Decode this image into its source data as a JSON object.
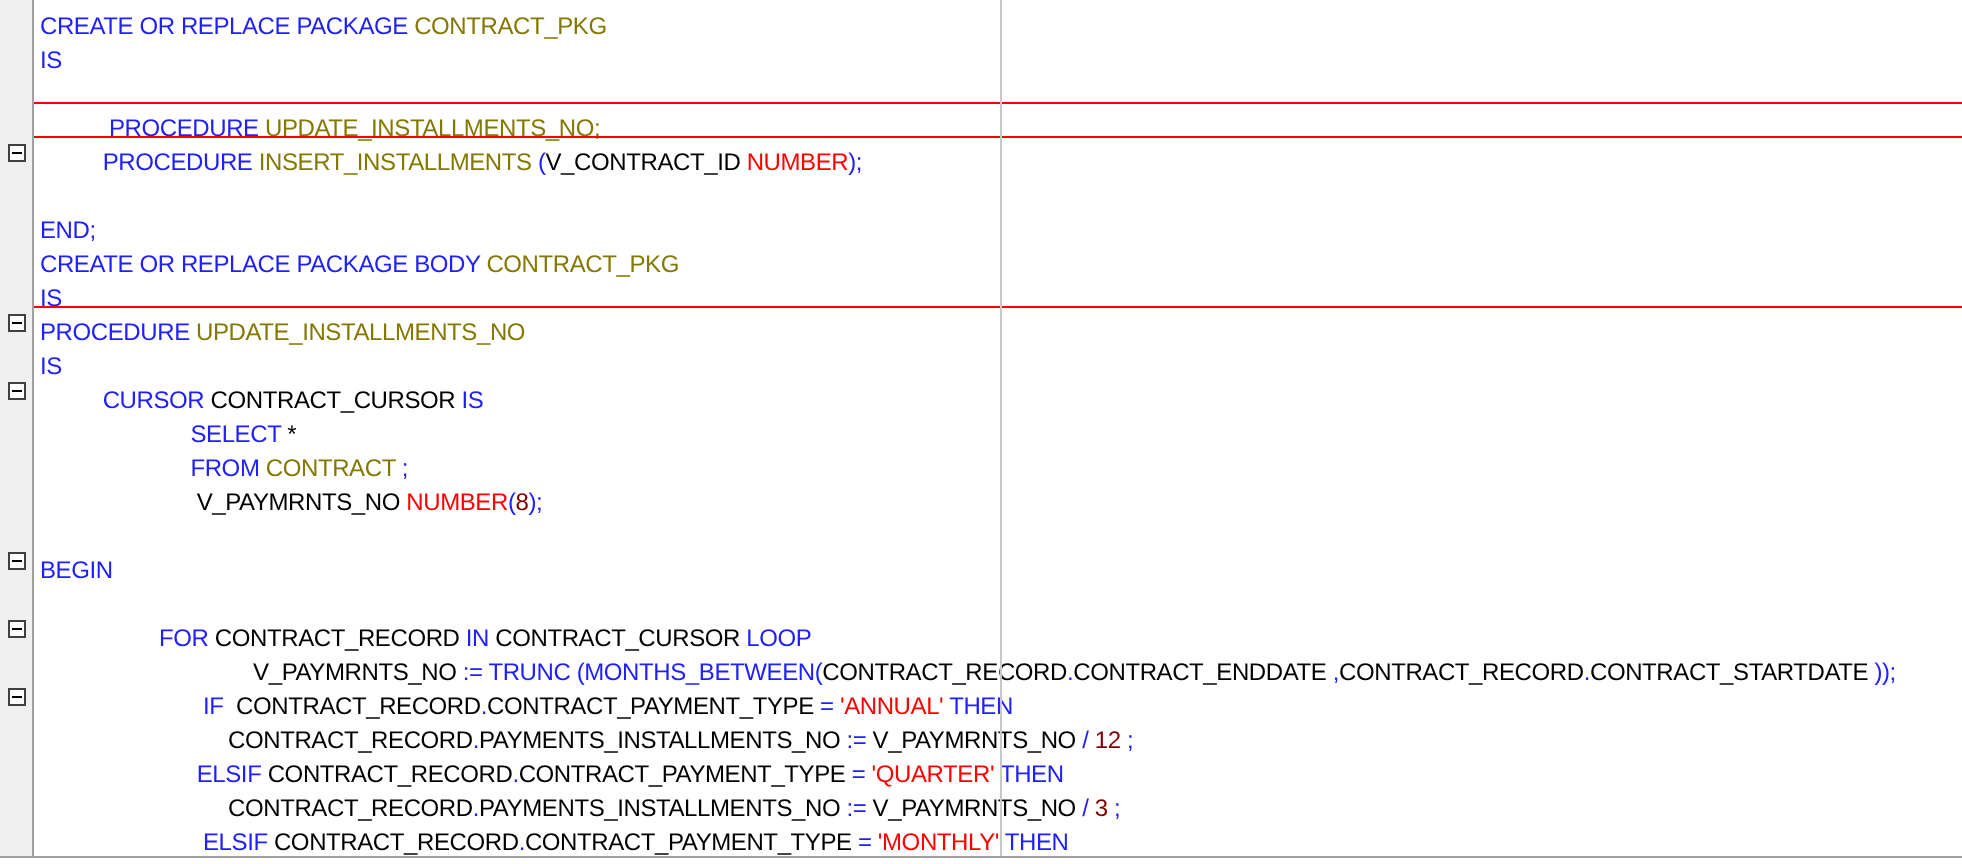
{
  "editor": {
    "lines": [
      {
        "separator": false,
        "tokens": [
          {
            "text": "CREATE OR REPLACE PACKAGE ",
            "kind": "keyword"
          },
          {
            "text": "CONTRACT_PKG",
            "kind": "identifier"
          }
        ]
      },
      {
        "separator": false,
        "tokens": [
          {
            "text": "IS",
            "kind": "keyword"
          }
        ]
      },
      {
        "separator": false
      },
      {
        "separator": true,
        "tokens": [
          {
            "text": "           PROCEDURE ",
            "kind": "keyword"
          },
          {
            "text": "UPDATE_INSTALLMENTS_NO;",
            "kind": "identifier"
          }
        ]
      },
      {
        "separator": true,
        "expanded": true,
        "tokens": [
          {
            "text": "          PROCEDURE ",
            "kind": "keyword"
          },
          {
            "text": "INSERT_INSTALLMENTS ",
            "kind": "identifier"
          },
          {
            "text": "(",
            "kind": "operator"
          },
          {
            "text": "V_CONTRACT_ID ",
            "kind": "plain"
          },
          {
            "text": "NUMBER",
            "kind": "type"
          },
          {
            "text": ");",
            "kind": "operator"
          }
        ]
      },
      {
        "separator": false
      },
      {
        "separator": false,
        "tokens": [
          {
            "text": "END;",
            "kind": "keyword"
          }
        ]
      },
      {
        "separator": false,
        "tokens": [
          {
            "text": "CREATE OR REPLACE PACKAGE BODY ",
            "kind": "keyword"
          },
          {
            "text": "CONTRACT_PKG",
            "kind": "identifier"
          }
        ]
      },
      {
        "separator": false,
        "tokens": [
          {
            "text": "IS",
            "kind": "keyword"
          }
        ]
      },
      {
        "separator": true,
        "expanded": true,
        "tokens": [
          {
            "text": "PROCEDURE ",
            "kind": "keyword"
          },
          {
            "text": "UPDATE_INSTALLMENTS_NO",
            "kind": "identifier"
          }
        ]
      },
      {
        "separator": false,
        "tokens": [
          {
            "text": "IS",
            "kind": "keyword"
          }
        ]
      },
      {
        "separator": false,
        "expanded": true,
        "tokens": [
          {
            "text": "          CURSOR ",
            "kind": "keyword"
          },
          {
            "text": "CONTRACT_CURSOR ",
            "kind": "plain"
          },
          {
            "text": "IS",
            "kind": "keyword"
          }
        ]
      },
      {
        "separator": false,
        "tokens": [
          {
            "text": "                        SELECT ",
            "kind": "keyword"
          },
          {
            "text": "*",
            "kind": "plain"
          }
        ]
      },
      {
        "separator": false,
        "tokens": [
          {
            "text": "                        FROM ",
            "kind": "keyword"
          },
          {
            "text": "CONTRACT ",
            "kind": "identifier"
          },
          {
            "text": ";",
            "kind": "operator"
          }
        ]
      },
      {
        "separator": false,
        "tokens": [
          {
            "text": "                         V_PAYMRNTS_NO ",
            "kind": "plain"
          },
          {
            "text": "NUMBER",
            "kind": "type"
          },
          {
            "text": "(",
            "kind": "operator"
          },
          {
            "text": "8",
            "kind": "number"
          },
          {
            "text": ");",
            "kind": "operator"
          }
        ]
      },
      {
        "separator": false
      },
      {
        "separator": false,
        "expanded": true,
        "tokens": [
          {
            "text": "BEGIN",
            "kind": "keyword"
          }
        ]
      },
      {
        "separator": false
      },
      {
        "separator": false,
        "expanded": true,
        "tokens": [
          {
            "text": "                   FOR ",
            "kind": "keyword"
          },
          {
            "text": "CONTRACT_RECORD ",
            "kind": "plain"
          },
          {
            "text": "IN ",
            "kind": "keyword"
          },
          {
            "text": "CONTRACT_CURSOR ",
            "kind": "plain"
          },
          {
            "text": "LOOP",
            "kind": "keyword"
          }
        ]
      },
      {
        "separator": false,
        "tokens": [
          {
            "text": "                                  V_PAYMRNTS_NO ",
            "kind": "plain"
          },
          {
            "text": ":= TRUNC (MONTHS_BETWEEN(",
            "kind": "keyword"
          },
          {
            "text": "CONTRACT_RECORD",
            "kind": "plain"
          },
          {
            "text": ".",
            "kind": "operator"
          },
          {
            "text": "CONTRACT_ENDDATE ",
            "kind": "plain"
          },
          {
            "text": ",",
            "kind": "operator"
          },
          {
            "text": "CONTRACT_RECORD",
            "kind": "plain"
          },
          {
            "text": ".",
            "kind": "operator"
          },
          {
            "text": "CONTRACT_STARTDATE ",
            "kind": "plain"
          },
          {
            "text": "));",
            "kind": "operator"
          }
        ]
      },
      {
        "separator": false,
        "expanded": true,
        "tokens": [
          {
            "text": "                          IF  ",
            "kind": "keyword"
          },
          {
            "text": "CONTRACT_RECORD",
            "kind": "plain"
          },
          {
            "text": ".",
            "kind": "operator"
          },
          {
            "text": "CONTRACT_PAYMENT_TYPE ",
            "kind": "plain"
          },
          {
            "text": "= ",
            "kind": "operator"
          },
          {
            "text": "'ANNUAL' ",
            "kind": "string"
          },
          {
            "text": "THEN",
            "kind": "keyword"
          }
        ]
      },
      {
        "separator": false,
        "tokens": [
          {
            "text": "                              CONTRACT_RECORD",
            "kind": "plain"
          },
          {
            "text": ".",
            "kind": "operator"
          },
          {
            "text": "PAYMENTS_INSTALLMENTS_NO ",
            "kind": "plain"
          },
          {
            "text": ":= ",
            "kind": "operator"
          },
          {
            "text": "V_PAYMRNTS_NO ",
            "kind": "plain"
          },
          {
            "text": "/ ",
            "kind": "operator"
          },
          {
            "text": "12 ",
            "kind": "number"
          },
          {
            "text": ";",
            "kind": "operator"
          }
        ]
      },
      {
        "separator": false,
        "tokens": [
          {
            "text": "                         ELSIF ",
            "kind": "keyword"
          },
          {
            "text": "CONTRACT_RECORD",
            "kind": "plain"
          },
          {
            "text": ".",
            "kind": "operator"
          },
          {
            "text": "CONTRACT_PAYMENT_TYPE ",
            "kind": "plain"
          },
          {
            "text": "= ",
            "kind": "operator"
          },
          {
            "text": "'QUARTER' ",
            "kind": "string"
          },
          {
            "text": "THEN",
            "kind": "keyword"
          }
        ]
      },
      {
        "separator": false,
        "tokens": [
          {
            "text": "                              CONTRACT_RECORD",
            "kind": "plain"
          },
          {
            "text": ".",
            "kind": "operator"
          },
          {
            "text": "PAYMENTS_INSTALLMENTS_NO ",
            "kind": "plain"
          },
          {
            "text": ":= ",
            "kind": "operator"
          },
          {
            "text": "V_PAYMRNTS_NO ",
            "kind": "plain"
          },
          {
            "text": "/ ",
            "kind": "operator"
          },
          {
            "text": "3 ",
            "kind": "number"
          },
          {
            "text": ";",
            "kind": "operator"
          }
        ]
      },
      {
        "separator": false,
        "tokens": [
          {
            "text": "                          ELSIF ",
            "kind": "keyword"
          },
          {
            "text": "CONTRACT_RECORD",
            "kind": "plain"
          },
          {
            "text": ".",
            "kind": "operator"
          },
          {
            "text": "CONTRACT_PAYMENT_TYPE ",
            "kind": "plain"
          },
          {
            "text": "= ",
            "kind": "operator"
          },
          {
            "text": "'MONTHLY' ",
            "kind": "string"
          },
          {
            "text": "THEN",
            "kind": "keyword"
          }
        ]
      }
    ]
  }
}
